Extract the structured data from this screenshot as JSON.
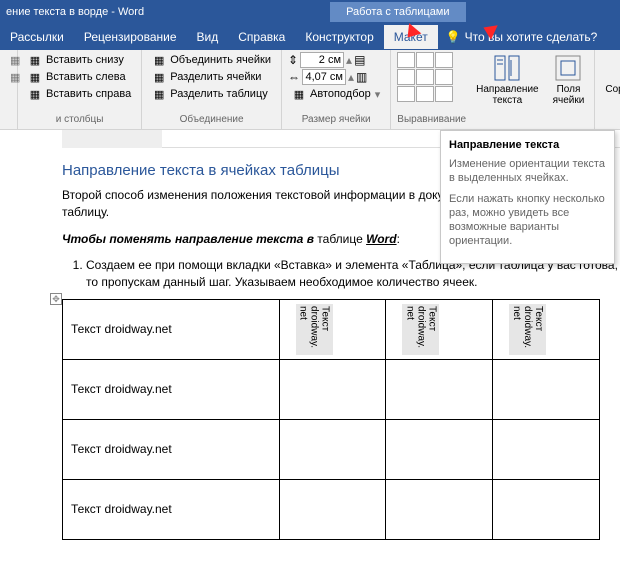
{
  "titlebar": {
    "title": "ение текста в ворде  -  Word",
    "context": "Работа с таблицами"
  },
  "tabs": {
    "items": [
      "Рассылки",
      "Рецензирование",
      "Вид",
      "Справка",
      "Конструктор",
      "Макет"
    ],
    "tellme": "Что вы хотите сделать?"
  },
  "ribbon": {
    "insert": {
      "below": "Вставить снизу",
      "left": "Вставить слева",
      "right": "Вставить справа",
      "label": "и столбцы"
    },
    "merge": {
      "merge": "Объединить ячейки",
      "split": "Разделить ячейки",
      "splitTable": "Разделить таблицу",
      "label": "Объединение"
    },
    "size": {
      "h": "2 см",
      "w": "4,07 см",
      "auto": "Автоподбор",
      "label": "Размер ячейки"
    },
    "align": {
      "direction": "Направление текста",
      "margins": "Поля ячейки",
      "label": "Выравнивание"
    },
    "sort": {
      "sort": "Сортировка"
    }
  },
  "tooltip": {
    "title": "Направление текста",
    "p1": "Изменение ориентации текста в выделенных ячейках.",
    "p2": "Если нажать кнопку несколько раз, можно увидеть все возможные варианты ориентации."
  },
  "doc": {
    "title": "Направление текста в ячейках таблицы",
    "p1a": "Второй способ изменения положения текстовой информации в докум",
    "p1b": "таблицу.",
    "p2a": "Чтобы поменять направление текста в",
    "p2b": " таблице ",
    "p2c": "Word",
    "p2d": ":",
    "li1": "Создаем ее при помощи вкладки «Вставка» и элемента «Таблица», если таблица у вас готова, то пропускам данный шаг. Указываем необходимое количество ячеек.",
    "cellH": "Текст droidway.net",
    "cellV": "Текст droidway. net"
  }
}
